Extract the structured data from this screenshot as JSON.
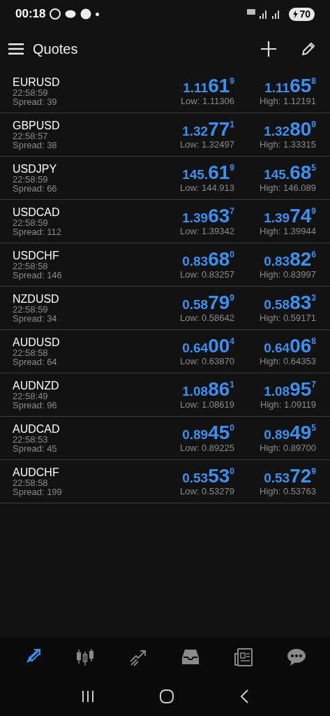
{
  "status_bar": {
    "time": "00:18",
    "battery": "70"
  },
  "header": {
    "title": "Quotes"
  },
  "quotes": [
    {
      "symbol": "EURUSD",
      "time": "22:58:59",
      "spread": "Spread: 39",
      "bid": {
        "pre": "1.11",
        "big": "61",
        "sup": "9"
      },
      "ask": {
        "pre": "1.11",
        "big": "65",
        "sup": "8"
      },
      "low": "Low: 1.11306",
      "high": "High: 1.12191"
    },
    {
      "symbol": "GBPUSD",
      "time": "22:58:57",
      "spread": "Spread: 38",
      "bid": {
        "pre": "1.32",
        "big": "77",
        "sup": "1"
      },
      "ask": {
        "pre": "1.32",
        "big": "80",
        "sup": "9"
      },
      "low": "Low: 1.32497",
      "high": "High: 1.33315"
    },
    {
      "symbol": "USDJPY",
      "time": "22:58:59",
      "spread": "Spread: 66",
      "bid": {
        "pre": "145.",
        "big": "61",
        "sup": "9"
      },
      "ask": {
        "pre": "145.",
        "big": "68",
        "sup": "5"
      },
      "low": "Low: 144.913",
      "high": "High: 146.089"
    },
    {
      "symbol": "USDCAD",
      "time": "22:58:59",
      "spread": "Spread: 112",
      "bid": {
        "pre": "1.39",
        "big": "63",
        "sup": "7"
      },
      "ask": {
        "pre": "1.39",
        "big": "74",
        "sup": "9"
      },
      "low": "Low: 1.39342",
      "high": "High: 1.39944"
    },
    {
      "symbol": "USDCHF",
      "time": "22:58:58",
      "spread": "Spread: 146",
      "bid": {
        "pre": "0.83",
        "big": "68",
        "sup": "0"
      },
      "ask": {
        "pre": "0.83",
        "big": "82",
        "sup": "6"
      },
      "low": "Low: 0.83257",
      "high": "High: 0.83997"
    },
    {
      "symbol": "NZDUSD",
      "time": "22:58:59",
      "spread": "Spread: 34",
      "bid": {
        "pre": "0.58",
        "big": "79",
        "sup": "9"
      },
      "ask": {
        "pre": "0.58",
        "big": "83",
        "sup": "3"
      },
      "low": "Low: 0.58642",
      "high": "High: 0.59171"
    },
    {
      "symbol": "AUDUSD",
      "time": "22:58:58",
      "spread": "Spread: 64",
      "bid": {
        "pre": "0.64",
        "big": "00",
        "sup": "4"
      },
      "ask": {
        "pre": "0.64",
        "big": "06",
        "sup": "8"
      },
      "low": "Low: 0.63870",
      "high": "High: 0.64353"
    },
    {
      "symbol": "AUDNZD",
      "time": "22:58:49",
      "spread": "Spread: 96",
      "bid": {
        "pre": "1.08",
        "big": "86",
        "sup": "1"
      },
      "ask": {
        "pre": "1.08",
        "big": "95",
        "sup": "7"
      },
      "low": "Low: 1.08619",
      "high": "High: 1.09119"
    },
    {
      "symbol": "AUDCAD",
      "time": "22:58:53",
      "spread": "Spread: 45",
      "bid": {
        "pre": "0.89",
        "big": "45",
        "sup": "0"
      },
      "ask": {
        "pre": "0.89",
        "big": "49",
        "sup": "5"
      },
      "low": "Low: 0.89225",
      "high": "High: 0.89700"
    },
    {
      "symbol": "AUDCHF",
      "time": "22:58:58",
      "spread": "Spread: 199",
      "bid": {
        "pre": "0.53",
        "big": "53",
        "sup": "0"
      },
      "ask": {
        "pre": "0.53",
        "big": "72",
        "sup": "9"
      },
      "low": "Low: 0.53279",
      "high": "High: 0.53763"
    }
  ],
  "bottom_tabs": [
    {
      "kind": "quotes",
      "selected": true
    },
    {
      "kind": "chart",
      "selected": false
    },
    {
      "kind": "trade",
      "selected": false
    },
    {
      "kind": "history",
      "selected": false
    },
    {
      "kind": "news",
      "selected": false
    },
    {
      "kind": "chat",
      "selected": false
    }
  ]
}
